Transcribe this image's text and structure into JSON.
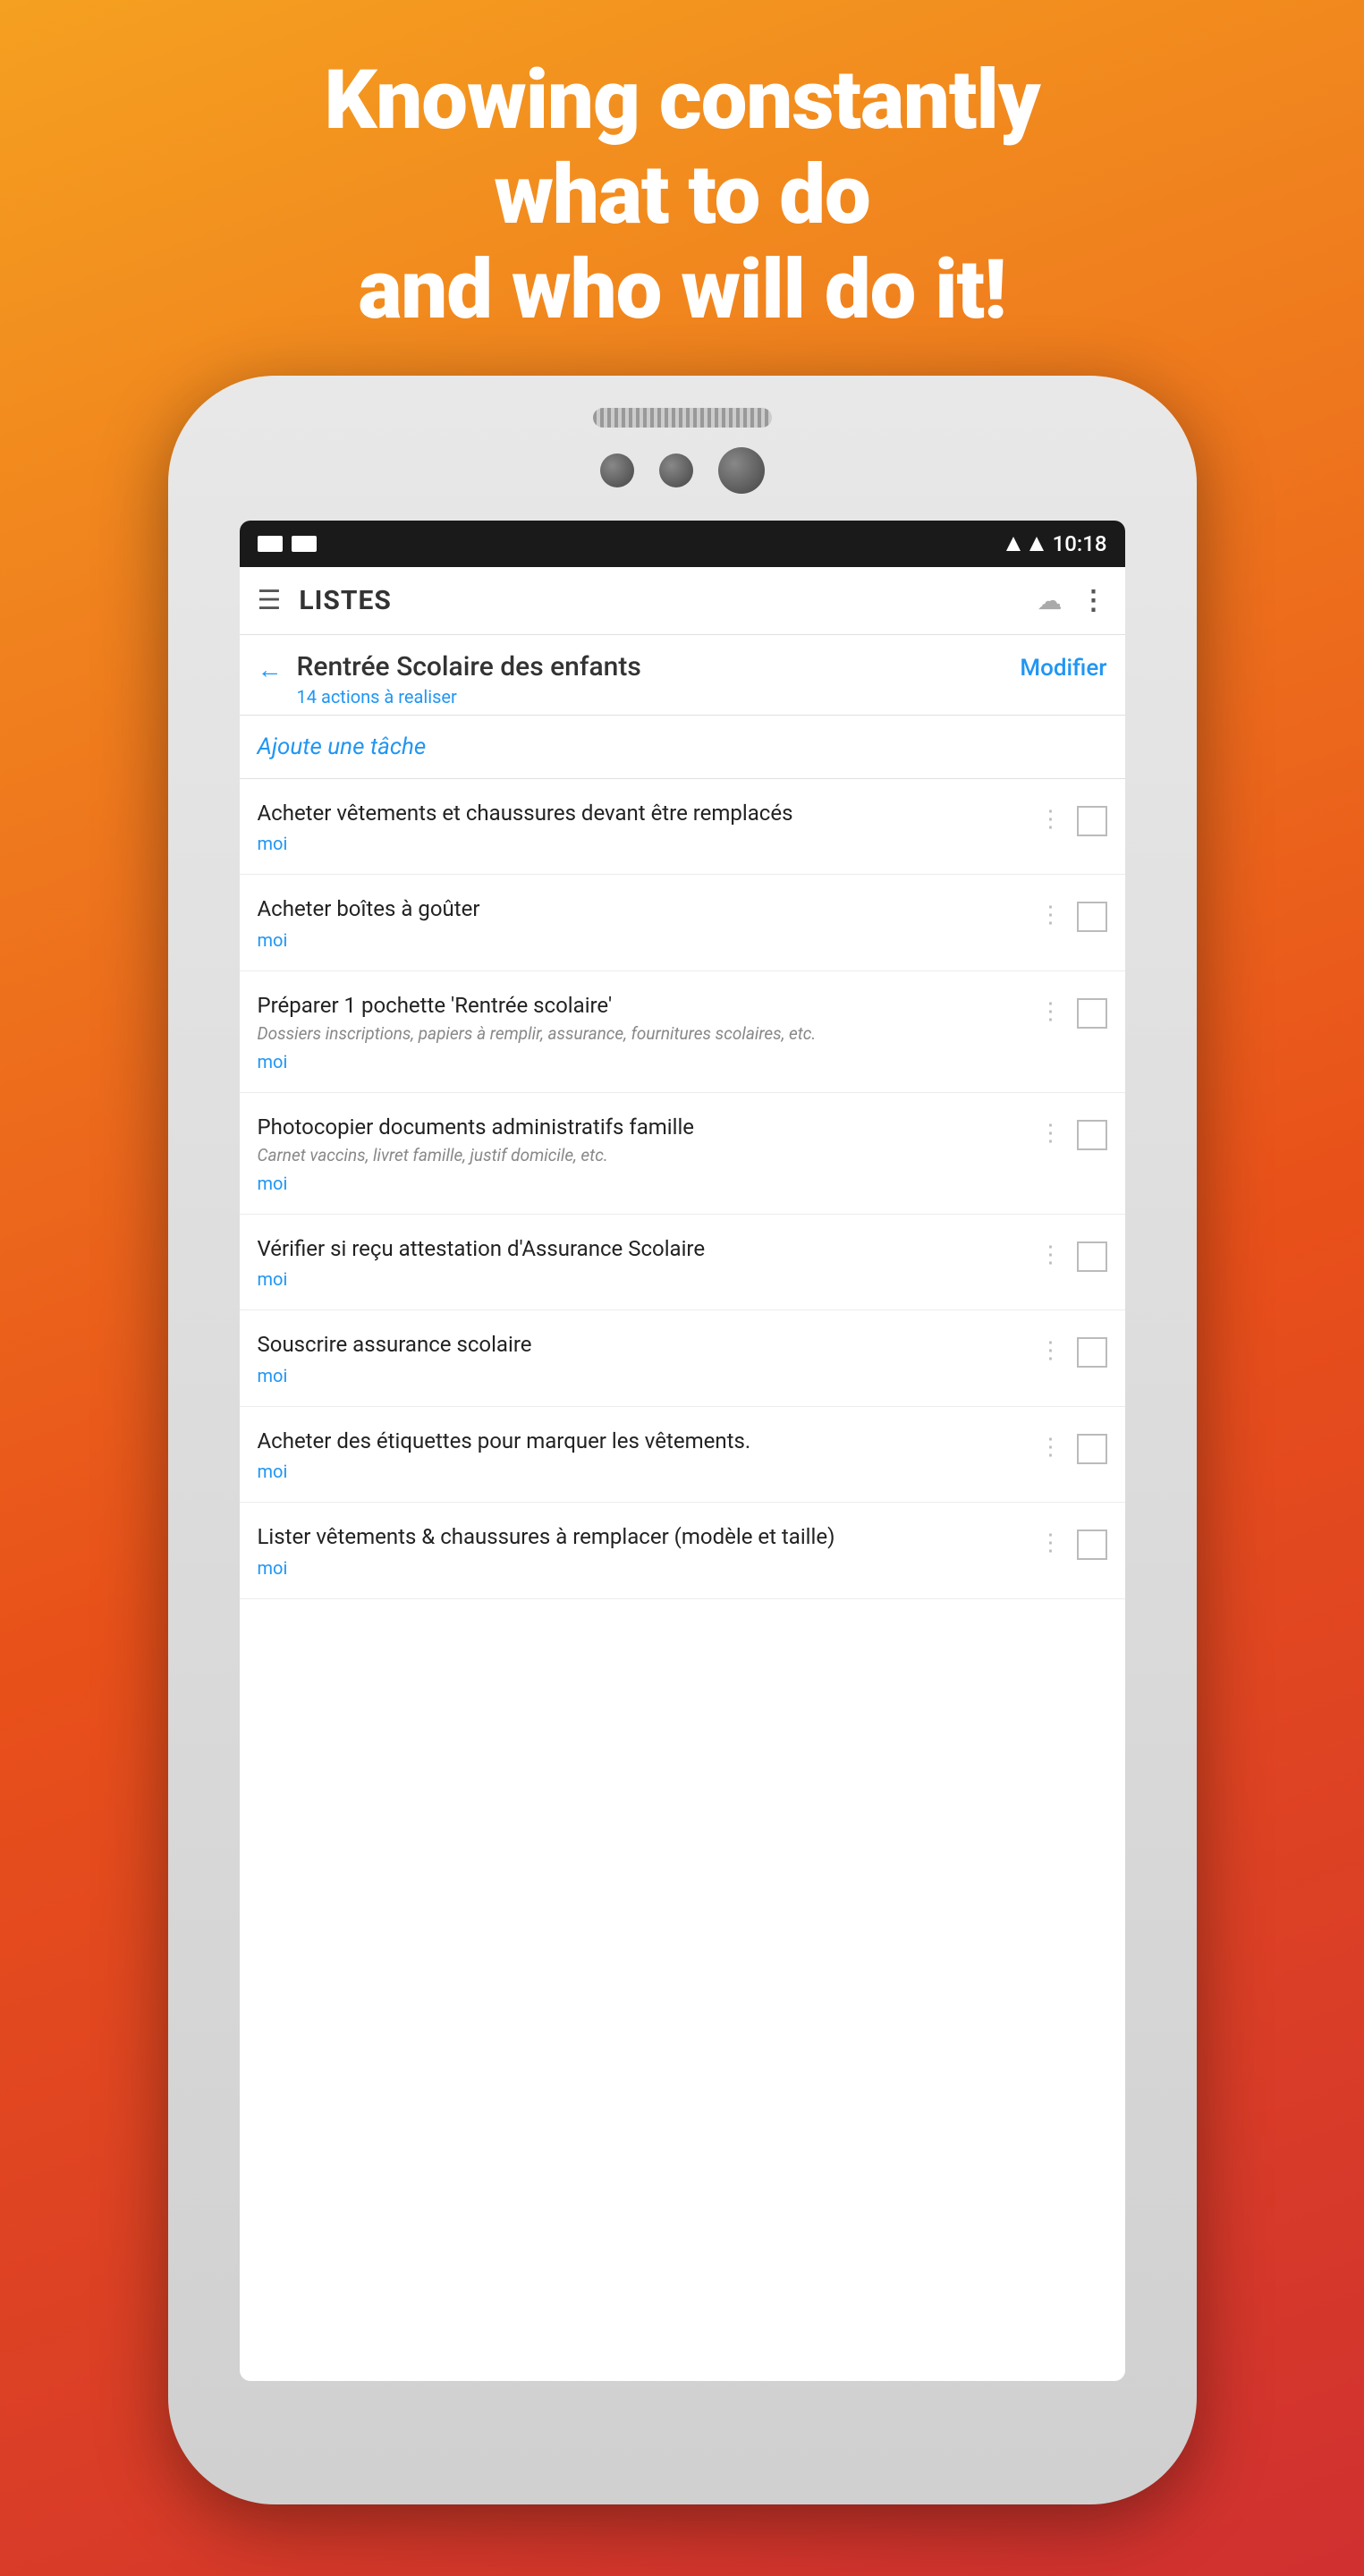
{
  "hero": {
    "line1": "Knowing constantly",
    "line2": "what to do",
    "line3": "and who will do it!"
  },
  "status_bar": {
    "time": "10:18"
  },
  "app_bar": {
    "title": "LISTES"
  },
  "list_header": {
    "title": "Rentrée Scolaire des enfants",
    "actions_count": "14 actions",
    "actions_suffix": " à realiser",
    "modifier": "Modifier"
  },
  "add_task": {
    "label": "Ajoute une tâche"
  },
  "tasks": [
    {
      "title": "Acheter vêtements et chaussures devant être remplacés",
      "note": "",
      "assignee": "moi"
    },
    {
      "title": "Acheter boîtes à goûter",
      "note": "",
      "assignee": "moi"
    },
    {
      "title": "Préparer 1 pochette 'Rentrée scolaire'",
      "note": "Dossiers inscriptions, papiers à remplir, assurance, fournitures scolaires, etc.",
      "assignee": "moi"
    },
    {
      "title": "Photocopier documents administratifs famille",
      "note": "Carnet vaccins, livret famille, justif domicile, etc.",
      "assignee": "moi"
    },
    {
      "title": "Vérifier si reçu attestation d'Assurance Scolaire",
      "note": "",
      "assignee": "moi"
    },
    {
      "title": "Souscrire assurance scolaire",
      "note": "",
      "assignee": "moi"
    },
    {
      "title": "Acheter des étiquettes pour marquer les vêtements.",
      "note": "",
      "assignee": "moi"
    },
    {
      "title": "Lister vêtements & chaussures à remplacer (modèle et taille)",
      "note": "",
      "assignee": "moi"
    }
  ],
  "colors": {
    "accent": "#2196F3",
    "background_gradient_start": "#f5a020",
    "background_gradient_end": "#d03030"
  }
}
